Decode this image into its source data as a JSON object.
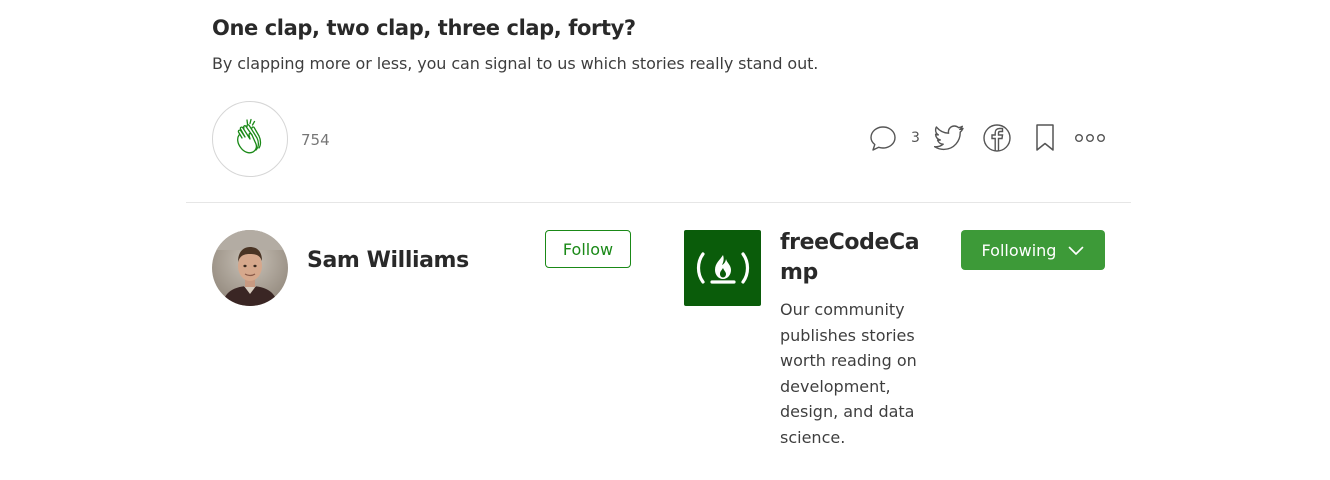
{
  "clap_prompt": {
    "title": "One clap, two clap, three clap, forty?",
    "subtitle": "By clapping more or less, you can signal to us which stories really stand out."
  },
  "actions": {
    "clap_count": "754",
    "response_count": "3",
    "icons": [
      "clap-icon",
      "comment-icon",
      "twitter-icon",
      "facebook-icon",
      "bookmark-icon",
      "more-icon"
    ]
  },
  "author": {
    "name": "Sam Williams",
    "follow_label": "Follow"
  },
  "publication": {
    "name": "freeCodeCamp",
    "description": "Our community publishes stories worth reading on development, design, and data science.",
    "following_label": "Following"
  },
  "colors": {
    "accent_green": "#1a8917",
    "publication_green": "#0a5c0a"
  }
}
